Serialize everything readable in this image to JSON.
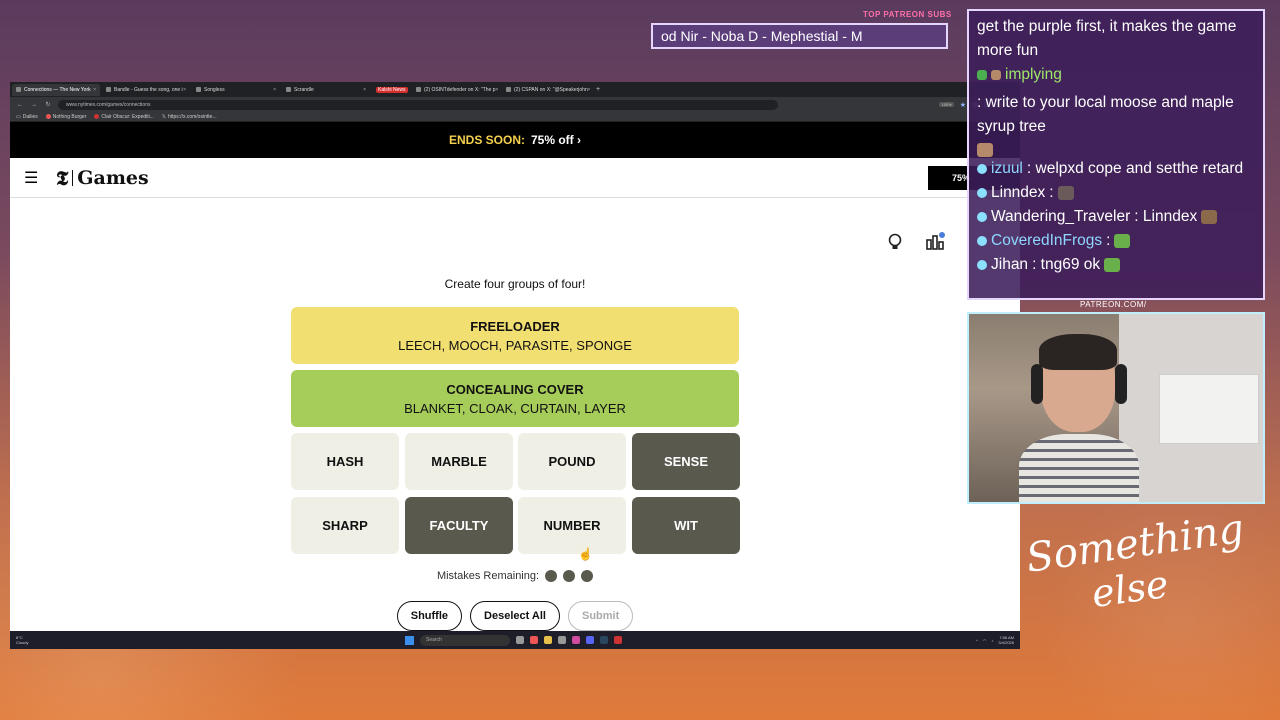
{
  "browser": {
    "tabs": [
      {
        "label": "Connections — The New York",
        "active": true
      },
      {
        "label": "Bandle - Guess the song, one i",
        "active": false
      },
      {
        "label": "Songless",
        "active": false
      },
      {
        "label": "Scrandle",
        "active": false
      },
      {
        "label": "Kalshi News",
        "active": false,
        "badge": true
      },
      {
        "label": "(2) OSINTdefender on X: \"The p",
        "active": false
      },
      {
        "label": "(2) CSPAN on X: \"@Speakerjohn",
        "active": false
      }
    ],
    "new_tab": "+",
    "url": "www.nytimes.com/games/connections",
    "zoom": "100%",
    "bookmarks": [
      "Dailies",
      "Nothing Burger",
      "Clair Obscur: Expediti...",
      "https://x.com/osintte..."
    ]
  },
  "promo": {
    "label": "ENDS SOON:",
    "offer": "75% off ›"
  },
  "header": {
    "logo_t": "𝕿",
    "logo_text": "Games",
    "subscribe": "75%"
  },
  "game": {
    "prompt": "Create four groups of four!",
    "solved": [
      {
        "title": "FREELOADER",
        "words": "LEECH, MOOCH, PARASITE, SPONGE",
        "color": "#f2df72"
      },
      {
        "title": "CONCEALING COVER",
        "words": "BLANKET, CLOAK, CURTAIN, LAYER",
        "color": "#a6cd5a"
      }
    ],
    "tiles": [
      {
        "word": "HASH",
        "selected": false
      },
      {
        "word": "MARBLE",
        "selected": false
      },
      {
        "word": "POUND",
        "selected": false
      },
      {
        "word": "SENSE",
        "selected": true
      },
      {
        "word": "SHARP",
        "selected": false
      },
      {
        "word": "FACULTY",
        "selected": true
      },
      {
        "word": "NUMBER",
        "selected": false
      },
      {
        "word": "WIT",
        "selected": true
      }
    ],
    "mistakes_label": "Mistakes Remaining:",
    "mistakes_remaining": 3,
    "buttons": {
      "shuffle": "Shuffle",
      "deselect": "Deselect All",
      "submit": "Submit"
    }
  },
  "taskbar": {
    "weather_temp": "8°C",
    "weather_desc": "Cloudy",
    "search": "Search",
    "time": "7:56 AM",
    "date": "3/4/2026"
  },
  "overlay": {
    "patreon_label": "TOP PATREON SUBS",
    "ticker": "od Nir - Noba D - Mephestial - M",
    "patreon_url": "PATREON.COM/",
    "chat": [
      {
        "user": "",
        "text": "get the purple first, it makes the game more fun",
        "user_color": ""
      },
      {
        "user": "implying",
        "text": ": write to your local moose and maple syrup tree",
        "user_color": "#9fe86a"
      },
      {
        "user": "izuul",
        "text": ": welpxd cope and setthe retard",
        "user_color": "#8fd6ff"
      },
      {
        "user": "Linndex",
        "text": ":",
        "user_color": "#ffffff"
      },
      {
        "user": "Wandering_Traveler",
        "text": ": Linndex",
        "user_color": "#ffffff"
      },
      {
        "user": "CoveredInFrogs",
        "text": ":",
        "user_color": "#8fd6ff"
      },
      {
        "user": "Jihan",
        "text": ": tng69 ok",
        "user_color": "#ffffff"
      }
    ],
    "signature_line1": "Something",
    "signature_line2": "else"
  }
}
